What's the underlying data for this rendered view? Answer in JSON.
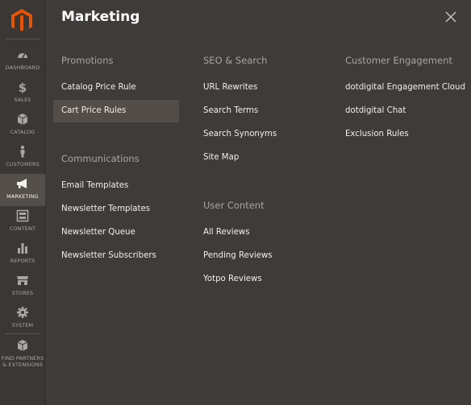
{
  "sidebar": {
    "items": [
      {
        "label": "DASHBOARD",
        "icon": "dashboard-icon"
      },
      {
        "label": "SALES",
        "icon": "dollar-icon"
      },
      {
        "label": "CATALOG",
        "icon": "box-icon"
      },
      {
        "label": "CUSTOMERS",
        "icon": "person-icon"
      },
      {
        "label": "MARKETING",
        "icon": "megaphone-icon",
        "active": true
      },
      {
        "label": "CONTENT",
        "icon": "layout-icon"
      },
      {
        "label": "REPORTS",
        "icon": "bar-chart-icon"
      },
      {
        "label": "STORES",
        "icon": "storefront-icon"
      },
      {
        "label": "SYSTEM",
        "icon": "gear-icon"
      },
      {
        "label": "FIND PARTNERS\n& EXTENSIONS",
        "icon": "cube-icon"
      }
    ]
  },
  "panel": {
    "title": "Marketing",
    "columns": [
      {
        "groups": [
          {
            "heading": "Promotions",
            "links": [
              "Catalog Price Rule",
              "Cart Price Rules"
            ]
          },
          {
            "heading": "Communications",
            "links": [
              "Email Templates",
              "Newsletter Templates",
              "Newsletter Queue",
              "Newsletter Subscribers"
            ]
          }
        ]
      },
      {
        "groups": [
          {
            "heading": "SEO & Search",
            "links": [
              "URL Rewrites",
              "Search Terms",
              "Search Synonyms",
              "Site Map"
            ]
          },
          {
            "heading": "User Content",
            "links": [
              "All Reviews",
              "Pending Reviews",
              "Yotpo Reviews"
            ]
          }
        ]
      },
      {
        "groups": [
          {
            "heading": "Customer Engagement",
            "links": [
              "dotdigital Engagement Cloud",
              "dotdigital Chat",
              "Exclusion Rules"
            ]
          }
        ]
      }
    ],
    "selected_link": "Cart Price Rules"
  },
  "colors": {
    "brand_orange": "#eb5202",
    "sidebar_bg": "#3a3734",
    "panel_bg": "#3f3b38",
    "selected_bg": "#524d49"
  }
}
